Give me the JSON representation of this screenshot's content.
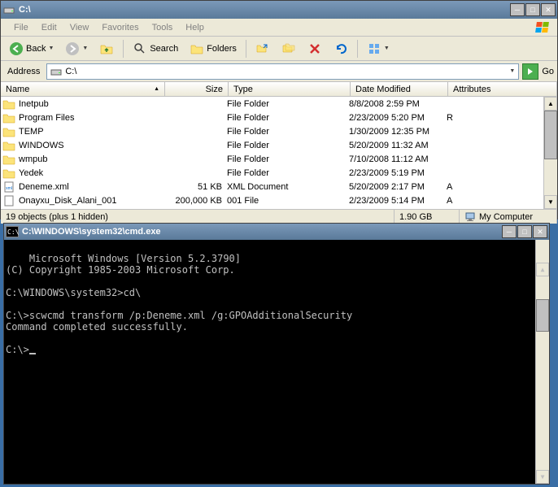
{
  "explorer": {
    "title": "C:\\",
    "menus": [
      "File",
      "Edit",
      "View",
      "Favorites",
      "Tools",
      "Help"
    ],
    "toolbar": {
      "back": "Back",
      "search": "Search",
      "folders": "Folders"
    },
    "address": {
      "label": "Address",
      "value": "C:\\",
      "go": "Go"
    },
    "columns": {
      "name": "Name",
      "size": "Size",
      "type": "Type",
      "date": "Date Modified",
      "attributes": "Attributes"
    },
    "files": [
      {
        "icon": "folder",
        "name": "Inetpub",
        "size": "",
        "type": "File Folder",
        "date": "8/8/2008 2:59 PM",
        "attr": ""
      },
      {
        "icon": "folder",
        "name": "Program Files",
        "size": "",
        "type": "File Folder",
        "date": "2/23/2009 5:20 PM",
        "attr": "R"
      },
      {
        "icon": "folder",
        "name": "TEMP",
        "size": "",
        "type": "File Folder",
        "date": "1/30/2009 12:35 PM",
        "attr": ""
      },
      {
        "icon": "folder",
        "name": "WINDOWS",
        "size": "",
        "type": "File Folder",
        "date": "5/20/2009 11:32 AM",
        "attr": ""
      },
      {
        "icon": "folder",
        "name": "wmpub",
        "size": "",
        "type": "File Folder",
        "date": "7/10/2008 11:12 AM",
        "attr": ""
      },
      {
        "icon": "folder",
        "name": "Yedek",
        "size": "",
        "type": "File Folder",
        "date": "2/23/2009 5:19 PM",
        "attr": ""
      },
      {
        "icon": "xml",
        "name": "Deneme.xml",
        "size": "51 KB",
        "type": "XML Document",
        "date": "5/20/2009 2:17 PM",
        "attr": "A"
      },
      {
        "icon": "file",
        "name": "Onayxu_Disk_Alani_001",
        "size": "200,000 KB",
        "type": "001 File",
        "date": "2/23/2009 5:14 PM",
        "attr": "A"
      }
    ],
    "status": {
      "objects": "19 objects (plus 1 hidden)",
      "size": "1.90 GB",
      "location": "My Computer"
    }
  },
  "cmd": {
    "title": "C:\\WINDOWS\\system32\\cmd.exe",
    "lines": [
      "Microsoft Windows [Version 5.2.3790]",
      "(C) Copyright 1985-2003 Microsoft Corp.",
      "",
      "C:\\WINDOWS\\system32>cd\\",
      "",
      "C:\\>scwcmd transform /p:Deneme.xml /g:GPOAdditionalSecurity",
      "Command completed successfully.",
      "",
      "C:\\>"
    ]
  }
}
